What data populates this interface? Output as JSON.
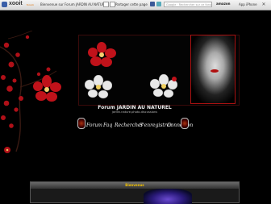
{
  "toolbar": {
    "logo_text": "xooit",
    "logo_sub": "forum",
    "site_name": "Bienvenue sur Forum JARDIN AU NATUREL",
    "share_label": "Partager cette page",
    "search_placeholder": "Google · Rechercher sur ce forum",
    "amazon_label": "amazon",
    "app_label": "App iPhone",
    "close_glyph": "✕"
  },
  "forum": {
    "title": "Forum JARDIN AU NATUREL",
    "subtitle": "jardin.nature.photo.discussions"
  },
  "nav": {
    "items": [
      "Forum",
      "Faq",
      "Rechercher",
      "S'enregistrer",
      "Connexion"
    ]
  },
  "panel": {
    "header": "Bienvenus"
  },
  "colors": {
    "background": "#000000",
    "accent_red": "#c0121a",
    "frangipani_white": "#e8e8e8",
    "panel_header_text": "#f0c000"
  }
}
